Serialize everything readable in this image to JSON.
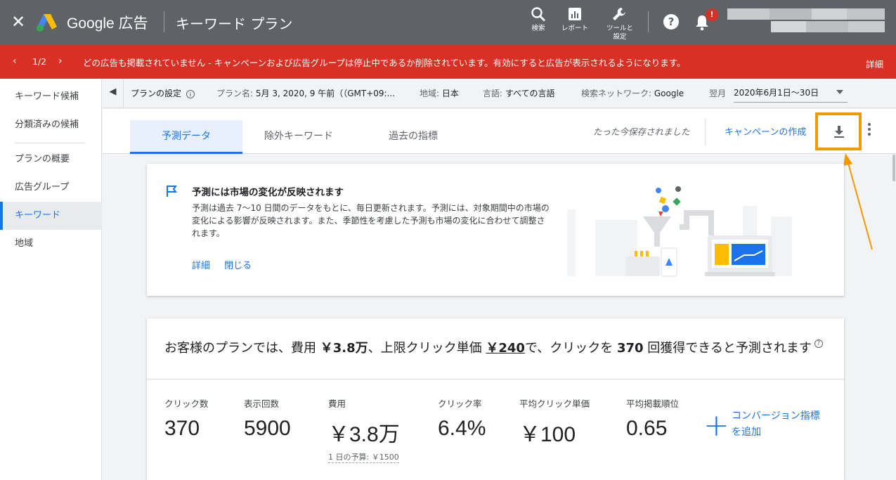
{
  "header": {
    "close_label": "✕",
    "brand": "Google 広告",
    "page_title": "キーワード プラン",
    "search_label": "検索",
    "reports_label": "レポート",
    "tools_label": "ツールと設定",
    "bell_badge": "!",
    "help_glyph": "?"
  },
  "banner": {
    "counter": "1/2",
    "message": "どの広告も掲載されていません - キャンペーンおよび広告グループは停止中であるか削除されています。有効にすると広告が表示されるようになります。",
    "detail_link": "詳細"
  },
  "sidebar": {
    "items": [
      {
        "label": "キーワード候補"
      },
      {
        "label": "分類済みの候補"
      },
      {
        "label": "プランの概要"
      },
      {
        "label": "広告グループ"
      },
      {
        "label": "キーワード"
      },
      {
        "label": "地域"
      }
    ]
  },
  "settings": {
    "label": "プランの設定",
    "plan_name_key": "プラン名:",
    "plan_name_val": "5月 3, 2020, 9 午前（（GMT+09:...",
    "region_key": "地域:",
    "region_val": "日本",
    "language_key": "言語:",
    "language_val": "すべての言語",
    "network_key": "検索ネットワーク:",
    "network_val": "Google",
    "period_key": "翌月",
    "period_val": "2020年6月1日〜30日"
  },
  "tabs": {
    "items": [
      {
        "label": "予測データ"
      },
      {
        "label": "除外キーワード"
      },
      {
        "label": "過去の指標"
      }
    ],
    "saved_text": "たった今保存されました",
    "create_campaign": "キャンペーンの作成"
  },
  "info_card": {
    "title": "予測には市場の変化が反映されます",
    "body": "予測は過去 7〜10 日間のデータをもとに、毎日更新されます。予測には、対象期間中の市場の変化による影響が反映されます。また、季節性を考慮した予測も市場の変化に合わせて調整されます。",
    "detail_link": "詳細",
    "close_link": "閉じる"
  },
  "forecast": {
    "headline_pre": "お客様のプランでは、費用 ",
    "cost": "￥3.8万",
    "headline_mid1": "、上限クリック単価 ",
    "max_cpc": "￥240",
    "headline_mid2": "で、クリックを ",
    "clicks": "370",
    "headline_post": " 回獲得できると予測されます",
    "metrics": [
      {
        "label": "クリック数",
        "value": "370"
      },
      {
        "label": "表示回数",
        "value": "5900"
      },
      {
        "label": "費用",
        "value": "￥3.8万"
      },
      {
        "label": "クリック率",
        "value": "6.4%"
      },
      {
        "label": "平均クリック単価",
        "value": "￥100"
      },
      {
        "label": "平均掲載順位",
        "value": "0.65"
      }
    ],
    "daily_budget": "1 日の予算: ￥1500",
    "add_conversion_line1": "コンバージョン指標",
    "add_conversion_line2": "を追加"
  },
  "colors": {
    "header_bg": "#5f6368",
    "banner_bg": "#d93025",
    "accent": "#1a73e8",
    "highlight": "#f29900"
  }
}
